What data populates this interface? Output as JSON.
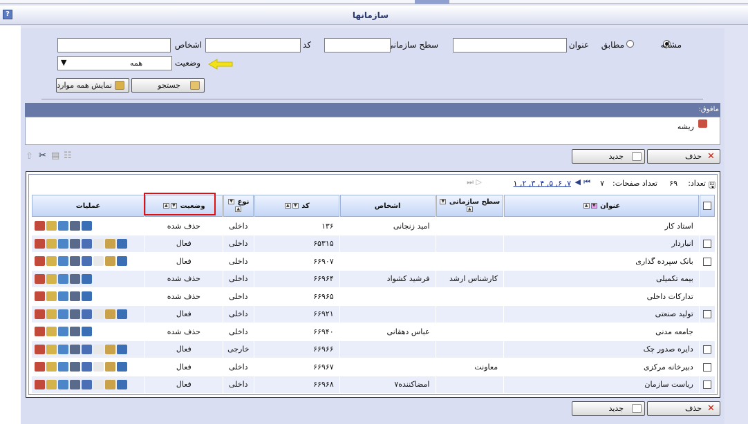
{
  "window": {
    "title": "سازمانها",
    "help_label": "?"
  },
  "search": {
    "mode_similar": "مشابه",
    "mode_exact": "مطابق",
    "title_label": "عنوان",
    "org_level_label": "سطح سازمانی",
    "code_label": "کد",
    "persons_label": "اشخاص",
    "status_label": "وضعیت",
    "status_value": "همه",
    "search_button": "جستجو",
    "show_all_button": "نمایش همه موارد"
  },
  "parent": {
    "label": "مافوق:",
    "root": "ریشه"
  },
  "actions": {
    "delete": "حذف",
    "new": "جدید"
  },
  "pager": {
    "count_label": "تعداد:",
    "count": "۶۹",
    "pages_label": "تعداد صفحات:",
    "pages": "۷",
    "pages_list": [
      "۱",
      "۲",
      "۳",
      "۴",
      "۵",
      "۶",
      "۷"
    ]
  },
  "columns": {
    "title": "عنوان",
    "org_level": "سطح سازمانی",
    "persons": "اشخاص",
    "code": "کد",
    "type": "نوع",
    "status": "وضعیت",
    "operations": "عملیات"
  },
  "rows": [
    {
      "title": "استاد کار",
      "org_level": "",
      "persons": "امید زنجانی",
      "code": "۱۳۶",
      "type": "داخلی",
      "status": "حذف شده",
      "checkbox": false
    },
    {
      "title": "انباردار",
      "org_level": "",
      "persons": "",
      "code": "۶۵۳۱۵",
      "type": "داخلی",
      "status": "فعال",
      "checkbox": true
    },
    {
      "title": "بانک سپرده گذاری",
      "org_level": "",
      "persons": "",
      "code": "۶۶۹۰۷",
      "type": "داخلی",
      "status": "فعال",
      "checkbox": true
    },
    {
      "title": "بیمه تکمیلی",
      "org_level": "کارشناس ارشد",
      "persons": "فرشید کشواد",
      "code": "۶۶۹۶۴",
      "type": "داخلی",
      "status": "حذف شده",
      "checkbox": false
    },
    {
      "title": "تدارکات داخلی",
      "org_level": "",
      "persons": "",
      "code": "۶۶۹۶۵",
      "type": "داخلی",
      "status": "حذف شده",
      "checkbox": false
    },
    {
      "title": "تولید صنعتی",
      "org_level": "",
      "persons": "",
      "code": "۶۶۹۲۱",
      "type": "داخلی",
      "status": "فعال",
      "checkbox": true
    },
    {
      "title": "جامعه مدنی",
      "org_level": "",
      "persons": "عباس دهقانی",
      "code": "۶۶۹۴۰",
      "type": "داخلی",
      "status": "حذف شده",
      "checkbox": false
    },
    {
      "title": "دایره صدور چک",
      "org_level": "",
      "persons": "",
      "code": "۶۶۹۶۶",
      "type": "خارجی",
      "status": "فعال",
      "checkbox": true
    },
    {
      "title": "دبیرخانه مرکزی",
      "org_level": "معاونت",
      "persons": "",
      "code": "۶۶۹۶۷",
      "type": "داخلی",
      "status": "فعال",
      "checkbox": true
    },
    {
      "title": "ریاست سازمان",
      "org_level": "",
      "persons": "امضاکننده۷",
      "code": "۶۶۹۶۸",
      "type": "داخلی",
      "status": "فعال",
      "checkbox": true
    }
  ],
  "colors": {
    "highlight": "#e01010",
    "arrow": "#f2e21a",
    "header_bar": "#6879a8"
  }
}
